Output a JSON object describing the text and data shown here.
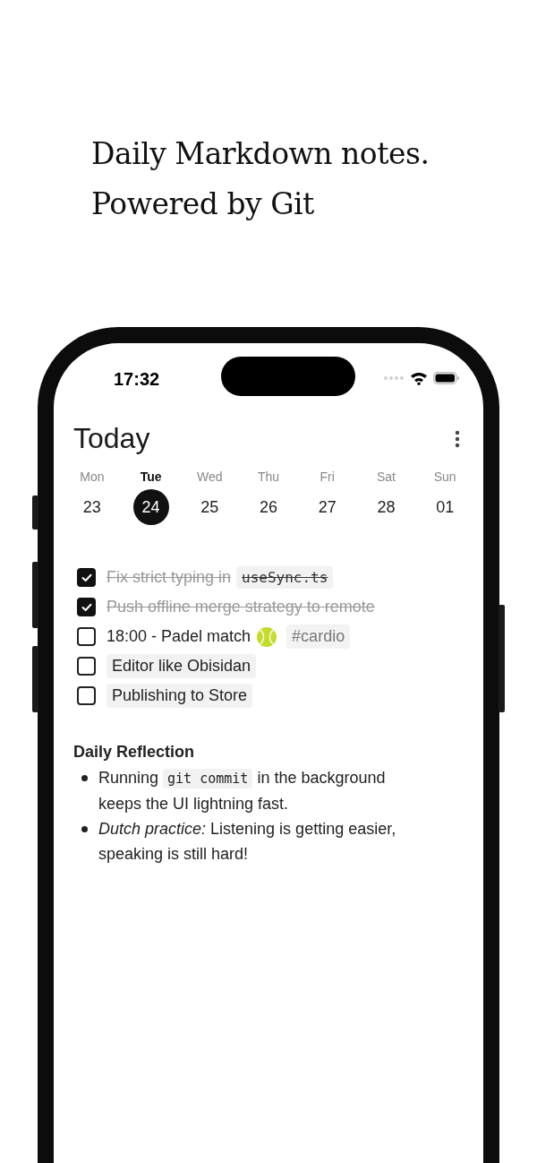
{
  "headline": [
    "Daily Markdown notes.",
    "Powered by Git"
  ],
  "status_bar": {
    "time": "17:32"
  },
  "header": {
    "title": "Today"
  },
  "week": [
    {
      "label": "Mon",
      "date": "23",
      "selected": false
    },
    {
      "label": "Tue",
      "date": "24",
      "selected": true
    },
    {
      "label": "Wed",
      "date": "25",
      "selected": false
    },
    {
      "label": "Thu",
      "date": "26",
      "selected": false
    },
    {
      "label": "Fri",
      "date": "27",
      "selected": false
    },
    {
      "label": "Sat",
      "date": "28",
      "selected": false
    },
    {
      "label": "Sun",
      "date": "01",
      "selected": false
    }
  ],
  "tasks": [
    {
      "checked": true,
      "parts": [
        {
          "kind": "text",
          "text": "Fix strict typing in"
        },
        {
          "kind": "code",
          "text": "useSync.ts"
        }
      ]
    },
    {
      "checked": true,
      "parts": [
        {
          "kind": "text",
          "text": "Push offline merge strategy to remote"
        }
      ]
    },
    {
      "checked": false,
      "parts": [
        {
          "kind": "text",
          "text": "18:00 - Padel match"
        },
        {
          "kind": "ball"
        },
        {
          "kind": "tag",
          "text": "#cardio"
        }
      ]
    },
    {
      "checked": false,
      "parts": [
        {
          "kind": "chip",
          "text": "Editor like Obisidan"
        }
      ]
    },
    {
      "checked": false,
      "parts": [
        {
          "kind": "chip",
          "text": "Publishing to Store"
        }
      ]
    }
  ],
  "reflection": {
    "heading": "Daily Reflection",
    "bullets": [
      [
        {
          "kind": "text",
          "text": "Running "
        },
        {
          "kind": "code",
          "text": "git commit"
        },
        {
          "kind": "text",
          "text": " in the background keeps the UI lightning fast."
        }
      ],
      [
        {
          "kind": "italic",
          "text": "Dutch practice:"
        },
        {
          "kind": "text",
          "text": " Listening is getting easier, speaking is still hard!"
        }
      ]
    ]
  }
}
